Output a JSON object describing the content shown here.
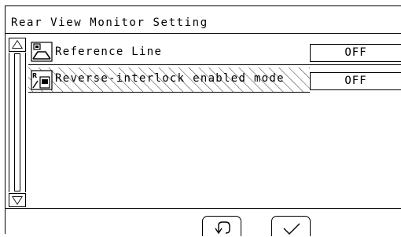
{
  "screen": {
    "title": "Rear View Monitor Setting"
  },
  "scrollbar": {
    "up_icon": "triangle-up-icon",
    "down_icon": "triangle-down-icon"
  },
  "settings": [
    {
      "label": "Reference Line",
      "value": "OFF",
      "icon": "reference-line-icon",
      "selected": false
    },
    {
      "label": "Reverse-interlock enabled mode",
      "value": "OFF",
      "icon": "reverse-interlock-icon",
      "selected": true
    }
  ],
  "footer": {
    "back_icon": "return-arrow-icon",
    "confirm_icon": "checkmark-icon"
  }
}
